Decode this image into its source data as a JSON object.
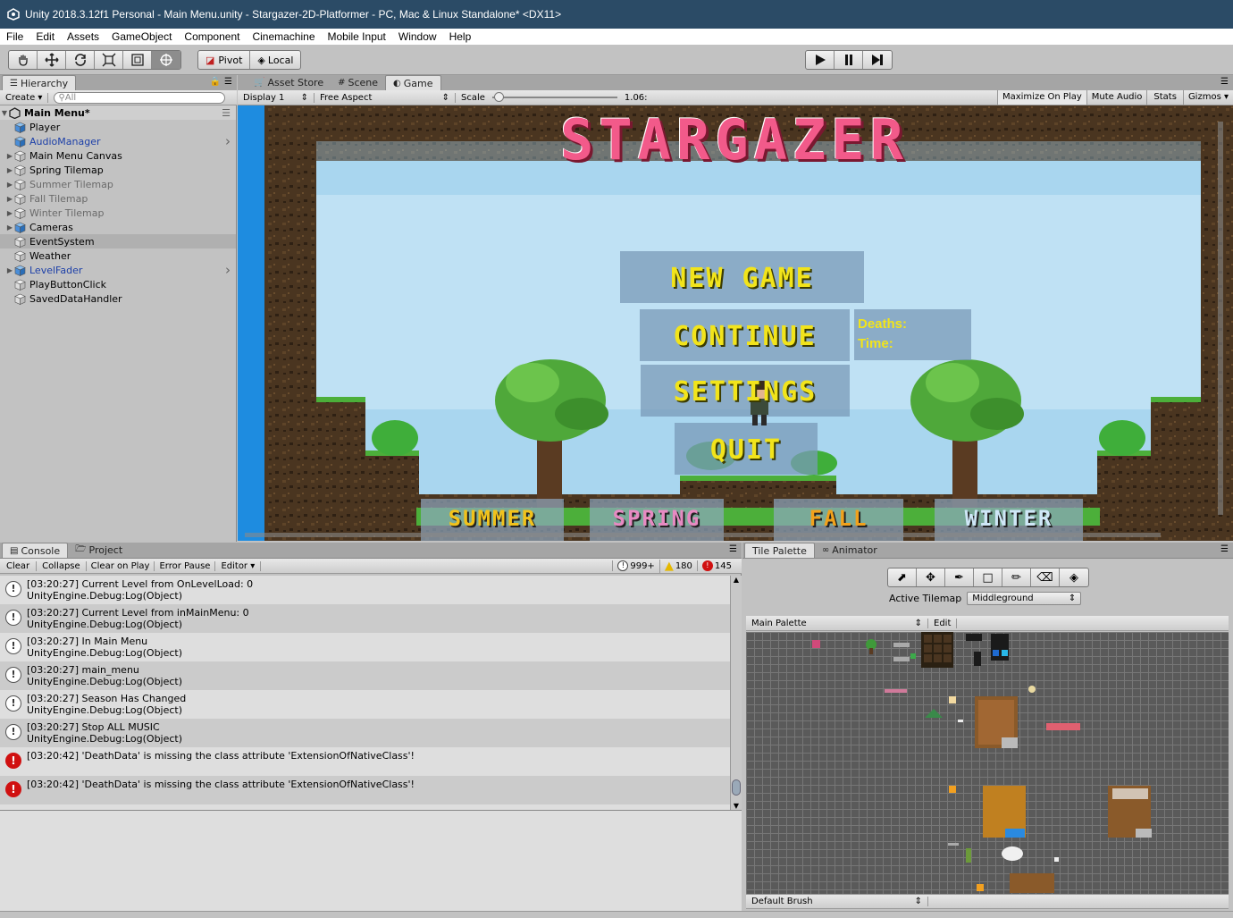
{
  "window": {
    "title": "Unity 2018.3.12f1 Personal - Main Menu.unity - Stargazer-2D-Platformer - PC, Mac & Linux Standalone* <DX11>"
  },
  "menu": [
    "File",
    "Edit",
    "Assets",
    "GameObject",
    "Component",
    "Cinemachine",
    "Mobile Input",
    "Window",
    "Help"
  ],
  "toolbar": {
    "pivot": "Pivot",
    "local": "Local"
  },
  "hierarchy": {
    "tab": "Hierarchy",
    "create": "Create",
    "search_placeholder": "All",
    "scene": "Main Menu*",
    "items": [
      {
        "label": "Player",
        "color": "#000000"
      },
      {
        "label": "AudioManager",
        "color": "#1c3fa8"
      },
      {
        "label": "Main Menu Canvas",
        "color": "#000000"
      },
      {
        "label": "Spring Tilemap",
        "color": "#000000"
      },
      {
        "label": "Summer Tilemap",
        "color": "#6a6a6a"
      },
      {
        "label": "Fall Tilemap",
        "color": "#6a6a6a"
      },
      {
        "label": "Winter Tilemap",
        "color": "#6a6a6a"
      },
      {
        "label": "Cameras",
        "color": "#000000"
      },
      {
        "label": "EventSystem",
        "color": "#000000"
      },
      {
        "label": "Weather",
        "color": "#000000"
      },
      {
        "label": "LevelFader",
        "color": "#1c3fa8"
      },
      {
        "label": "PlayButtonClick",
        "color": "#000000"
      },
      {
        "label": "SavedDataHandler",
        "color": "#000000"
      }
    ]
  },
  "gameview": {
    "tabs": [
      "Asset Store",
      "Scene",
      "Game"
    ],
    "display": "Display 1",
    "aspect": "Free Aspect",
    "scale_label": "Scale",
    "scale_value": "1.06:",
    "toggles": [
      "Maximize On Play",
      "Mute Audio",
      "Stats",
      "Gizmos"
    ]
  },
  "game": {
    "title": "STARGAZER",
    "buttons": [
      "NEW GAME",
      "CONTINUE",
      "SETTINGS",
      "QUIT"
    ],
    "deaths_label": "Deaths:",
    "time_label": "Time:",
    "seasons": [
      {
        "label": "SUMMER",
        "color": "#f2c21b"
      },
      {
        "label": "SPRING",
        "color": "#e78ac2"
      },
      {
        "label": "FALL",
        "color": "#f2a11b"
      },
      {
        "label": "WINTER",
        "color": "#cfe7f7"
      }
    ]
  },
  "console": {
    "tabs": [
      "Console",
      "Project"
    ],
    "buttons": [
      "Clear",
      "Collapse",
      "Clear on Play",
      "Error Pause",
      "Editor"
    ],
    "count_info": "999+",
    "count_warn": "180",
    "count_error": "145",
    "logs": [
      {
        "type": "info",
        "line1": "[03:20:27] Current Level from OnLevelLoad: 0",
        "line2": "UnityEngine.Debug:Log(Object)"
      },
      {
        "type": "info",
        "line1": "[03:20:27] Current Level from inMainMenu: 0",
        "line2": "UnityEngine.Debug:Log(Object)"
      },
      {
        "type": "info",
        "line1": "[03:20:27] In Main Menu",
        "line2": "UnityEngine.Debug:Log(Object)"
      },
      {
        "type": "info",
        "line1": "[03:20:27] main_menu",
        "line2": "UnityEngine.Debug:Log(Object)"
      },
      {
        "type": "info",
        "line1": "[03:20:27] Season Has Changed",
        "line2": "UnityEngine.Debug:Log(Object)"
      },
      {
        "type": "info",
        "line1": "[03:20:27] Stop ALL MUSIC",
        "line2": "UnityEngine.Debug:Log(Object)"
      },
      {
        "type": "error",
        "line1": "[03:20:42] 'DeathData' is missing the class attribute 'ExtensionOfNativeClass'!",
        "line2": ""
      },
      {
        "type": "error",
        "line1": "[03:20:42] 'DeathData' is missing the class attribute 'ExtensionOfNativeClass'!",
        "line2": ""
      }
    ]
  },
  "tilepalette": {
    "tabs": [
      "Tile Palette",
      "Animator"
    ],
    "active_tilemap_label": "Active Tilemap",
    "active_tilemap": "Middleground",
    "palette": "Main Palette",
    "edit": "Edit",
    "brush": "Default Brush"
  },
  "colors": {
    "sky": "#a9d6ef",
    "title_pink": "#f25a8a",
    "button_text": "#f2e41b",
    "error_red": "#d01010",
    "dirt": "#3d2b1a"
  }
}
